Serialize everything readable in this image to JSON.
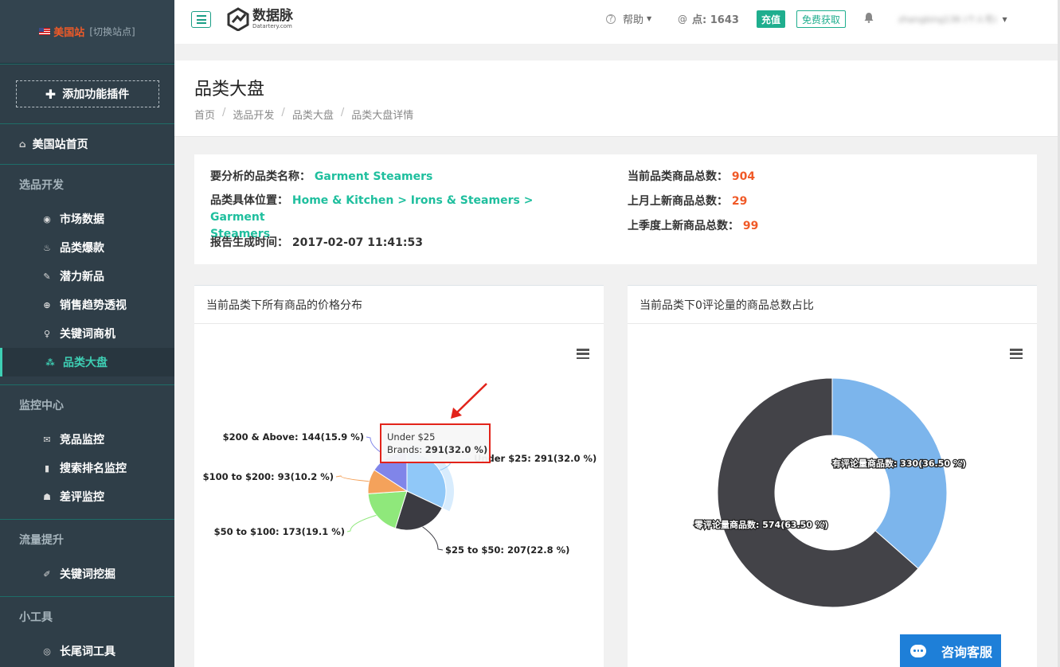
{
  "sidebar": {
    "site": "美国站",
    "switch": "[切换站点]",
    "add_plugin": "添加功能插件",
    "home": "美国站首页",
    "groups": [
      {
        "label": "选品开发",
        "items": [
          "市场数据",
          "品类爆款",
          "潜力新品",
          "销售趋势透视",
          "关键词商机",
          "品类大盘"
        ]
      },
      {
        "label": "监控中心",
        "items": [
          "竞品监控",
          "搜索排名监控",
          "差评监控"
        ]
      },
      {
        "label": "流量提升",
        "items": [
          "关键词挖掘"
        ]
      },
      {
        "label": "小工具",
        "items": [
          "长尾词工具"
        ]
      }
    ],
    "active_item": "品类大盘"
  },
  "header": {
    "logo_cn": "数据脉",
    "logo_en": "Datartery.com",
    "help": "帮助",
    "points": "点: 1643",
    "recharge": "充值",
    "free": "免费获取",
    "user": "zhangbing136 (个人号)"
  },
  "page": {
    "title": "品类大盘",
    "breadcrumb": [
      "首页",
      "选品开发",
      "品类大盘",
      "品类大盘详情"
    ]
  },
  "info": {
    "name_label": "要分析的品类名称：",
    "name_value": "Garment Steamers",
    "position_label": "品类具体位置：",
    "position_value_1": "Home & Kitchen > Irons & Steamers > Garment",
    "position_value_2": "Steamers",
    "time_label": "报告生成时间：",
    "time_value": "2017-02-07 11:41:53",
    "total_label": "当前品类商品总数：",
    "total_value": "904",
    "last_month_label": "上月上新商品总数：",
    "last_month_value": "29",
    "last_quarter_label": "上季度上新商品总数：",
    "last_quarter_value": "99"
  },
  "panels": {
    "left_title": "当前品类下所有商品的价格分布",
    "right_title": "当前品类下0评论量的商品总数占比"
  },
  "tooltip": {
    "line1": "Under $25",
    "line2_label": "Brands: ",
    "line2_value": "291(32.0 %)"
  },
  "chat": "咨询客服",
  "chart_data": [
    {
      "type": "pie",
      "title": "",
      "series_name": "Brands",
      "categories": [
        "Under $25",
        "$25 to $50",
        "$50 to $100",
        "$100 to $200",
        "$200 & Above"
      ],
      "values": [
        291,
        207,
        173,
        93,
        144
      ],
      "percents": [
        32.0,
        22.8,
        19.1,
        10.2,
        15.9
      ],
      "colors": [
        "#90c8f8",
        "#3b3b42",
        "#8fe87b",
        "#f4a25b",
        "#8085e9"
      ],
      "labels": [
        "Under $25: 291(32.0 %)",
        "$25 to $50: 207(22.8 %)",
        "$50 to $100: 173(19.1 %)",
        "$100 to $200: 93(10.2 %)",
        "$200 & Above: 144(15.9 %)"
      ]
    },
    {
      "type": "pie",
      "title": "",
      "donut": true,
      "categories": [
        "有评论量商品数",
        "零评论量商品数"
      ],
      "values": [
        330,
        574
      ],
      "percents": [
        36.5,
        63.5
      ],
      "colors": [
        "#7cb5ec",
        "#434348"
      ],
      "labels": [
        "有评论量商品数: 330(36.50 %)",
        "零评论量商品数: 574(63.50 %)"
      ]
    }
  ]
}
